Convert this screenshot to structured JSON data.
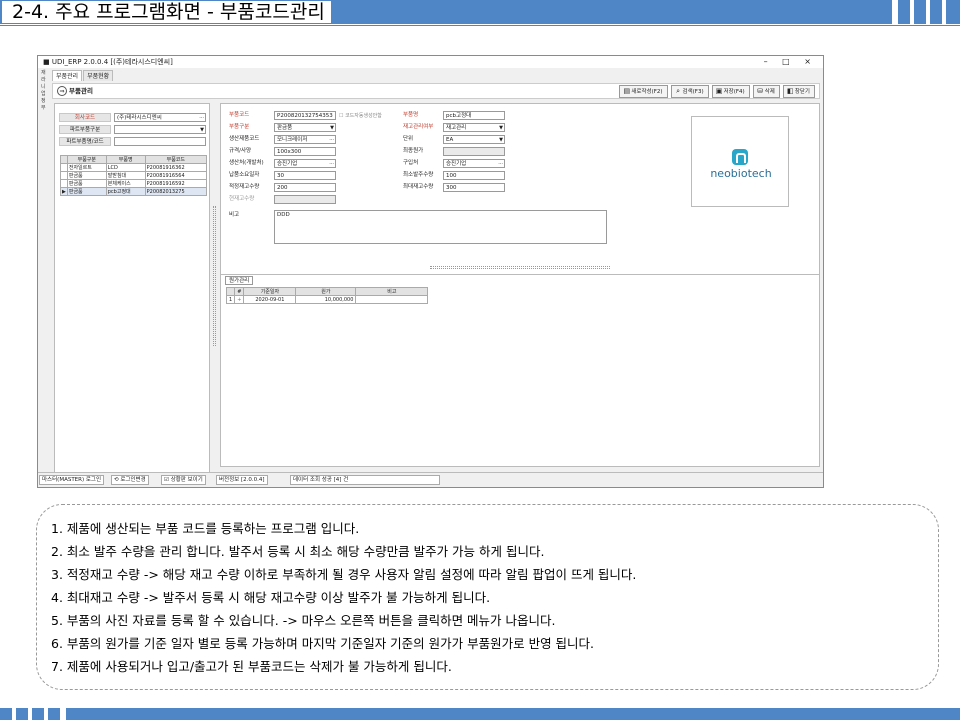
{
  "slide": {
    "title": "2-4. 주요 프로그램화면 - 부품코드관리"
  },
  "window": {
    "title": "UDI_ERP 2.0.0.4 [(주)테라시스디엔씨]",
    "controls": "– □ ×",
    "left_strip": "재\n라\n니\n업\n정\n부",
    "menu_tabs": [
      "부품관리",
      "부품현황"
    ],
    "toolbar": {
      "title": "부품관리",
      "nav": "⇒",
      "buttons": [
        {
          "icon": "new-doc-icon",
          "glyph": "▤",
          "label": "새로작성(F2)"
        },
        {
          "icon": "search-icon",
          "glyph": "⌕",
          "label": "검색(F3)"
        },
        {
          "icon": "save-icon",
          "glyph": "▣",
          "label": "저장(F4)"
        },
        {
          "icon": "delete-icon",
          "glyph": "⛁",
          "label": "삭제"
        },
        {
          "icon": "close-window-icon",
          "glyph": "◧",
          "label": "창닫기"
        }
      ]
    }
  },
  "left_panel": {
    "company_label": "회사코드",
    "company_value": "(주)테라시스디엔씨",
    "part_type_label": "파트부품구분",
    "part_type_value": "",
    "part_name_label": "파트부품명/코드",
    "part_name_value": "",
    "table": {
      "headers": [
        "부품구분",
        "부품명",
        "부품코드"
      ],
      "rows": [
        {
          "marker": "",
          "type": "전자일르트",
          "name": "LCD",
          "code": "P20081916362"
        },
        {
          "marker": "",
          "type": "판금품",
          "name": "발받침대",
          "code": "P20081916564"
        },
        {
          "marker": "",
          "type": "판금품",
          "name": "본체케이스",
          "code": "P20081916592"
        },
        {
          "marker": "▶",
          "type": "판금품",
          "name": "pcb고정대",
          "code": "P20082013275"
        }
      ]
    }
  },
  "detail": {
    "part_code_label": "부품코드",
    "part_code_value": "P200820132754353",
    "auto_code_label": "코드자동생성안함",
    "part_name_label": "부품명",
    "part_name_value": "pcb고정대",
    "part_type_label": "부품구분",
    "part_type_value": "판금품",
    "stock_mgmt_label": "재고관리여부",
    "stock_mgmt_value": "재고관리",
    "maker_code_label": "생산제품코드",
    "maker_code_value": "모니크레이저",
    "unit_label": "단위",
    "unit_value": "EA",
    "spec_label": "규격/사양",
    "spec_value": "100x300",
    "final_price_label": "최종원가",
    "final_price_value": "",
    "producer_label": "생산처(개발처)",
    "producer_value": "승진기업",
    "supplier_label": "구입처",
    "supplier_value": "승진기업",
    "lead_days_label": "납품소요일자",
    "lead_days_value": "30",
    "min_order_label": "최소발주수량",
    "min_order_value": "100",
    "safety_stock_label": "적정재고수량",
    "safety_stock_value": "200",
    "max_stock_label": "최대재고수량",
    "max_stock_value": "300",
    "current_stock_label": "현재고수량",
    "current_stock_value": "",
    "memo_label": "비고",
    "memo_value": "DDD",
    "logo_text": "neobiotech"
  },
  "price_grid": {
    "tab": "원가관리",
    "headers": [
      "#",
      "기준일자",
      "원가",
      "비고"
    ],
    "rows": [
      {
        "num": "1",
        "plus": "+",
        "date": "2020-09-01",
        "price": "10,000,000",
        "note": ""
      }
    ]
  },
  "status_bar": {
    "user": "마스터(MASTER) 로그인",
    "login_change": "로그인변경",
    "always_show": "상황판 보이기",
    "version": "버전정보 [2.0.0.4]",
    "message": "데이터 조회 성공 [4] 건"
  },
  "notes": [
    "1.  제품에 생산되는 부품 코드를 등록하는 프로그램 입니다.",
    "2.  최소 발주 수량을 관리 합니다. 발주서 등록 시 최소 해당 수량만큼 발주가 가능 하게 됩니다.",
    "3.  적정재고 수량 -> 해당 재고 수량 이하로 부족하게 될 경우 사용자 알림 설정에 따라 알림 팝업이 뜨게 됩니다.",
    "4.  최대재고 수량 -> 발주서 등록 시 해당 재고수량 이상 발주가 불 가능하게 됩니다.",
    "5.  부품의 사진 자료를 등록 할 수 있습니다. -> 마우스 오른쪽 버튼을 클릭하면 메뉴가 나옵니다.",
    "6.  부품의 원가를 기준 일자 별로 등록 가능하며 마지막 기준일자 기준의 원가가 부품원가로 반영 됩니다.",
    "7.  제품에 사용되거나 입고/출고가 된 부품코드는 삭제가 불 가능하게 됩니다."
  ],
  "colors": {
    "accent": "#4f86c6",
    "required_label": "#c0392b",
    "logo": "#2aa6c9"
  }
}
